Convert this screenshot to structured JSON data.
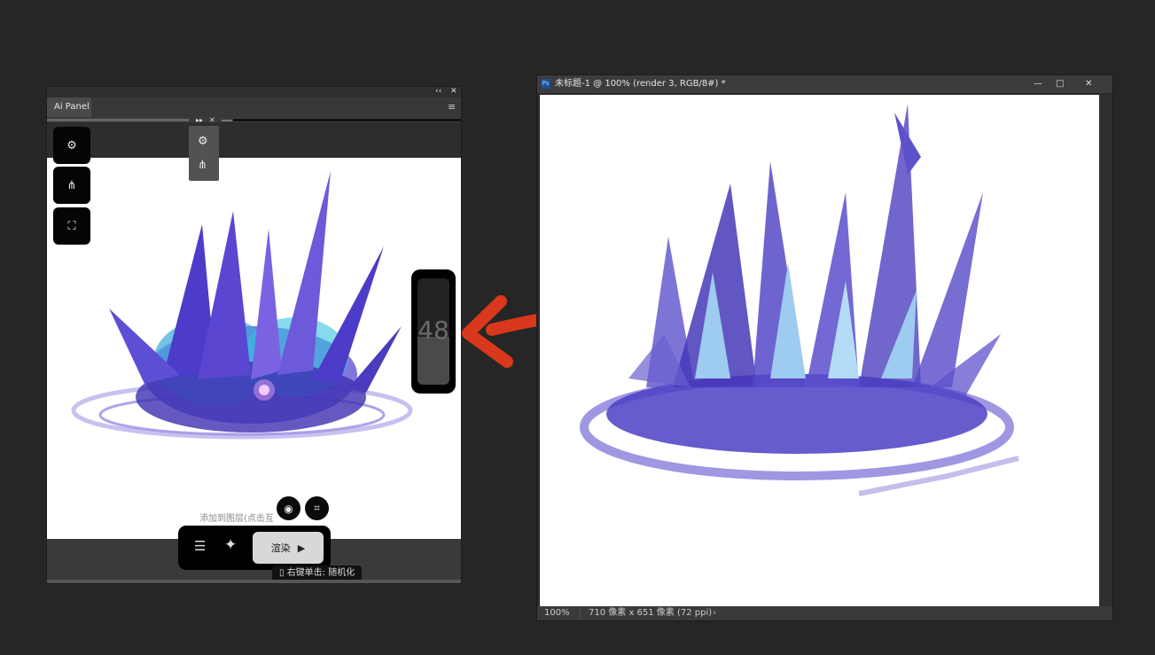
{
  "ai_panel": {
    "tab_label": "Ai Panel",
    "slider_value": "48",
    "slider_fill_fraction": 0.45,
    "hint_text": "添加到图层(点击互",
    "generate_label": "渲染",
    "tooltip_text": "右键单击: 随机化"
  },
  "ps_window": {
    "title": "未标题-1 @ 100% (render 3, RGB/8#) *",
    "app_badge": "Ps",
    "zoom": "100%",
    "doc_info": "710 像素 x 651 像素 (72 ppi)",
    "minimize_glyph": "—",
    "maximize_glyph": "□",
    "close_glyph": "✕"
  },
  "colors": {
    "arrow_red": "#d8381b",
    "effect_blue": "#5549c8",
    "effect_light": "#9ecbf0"
  }
}
